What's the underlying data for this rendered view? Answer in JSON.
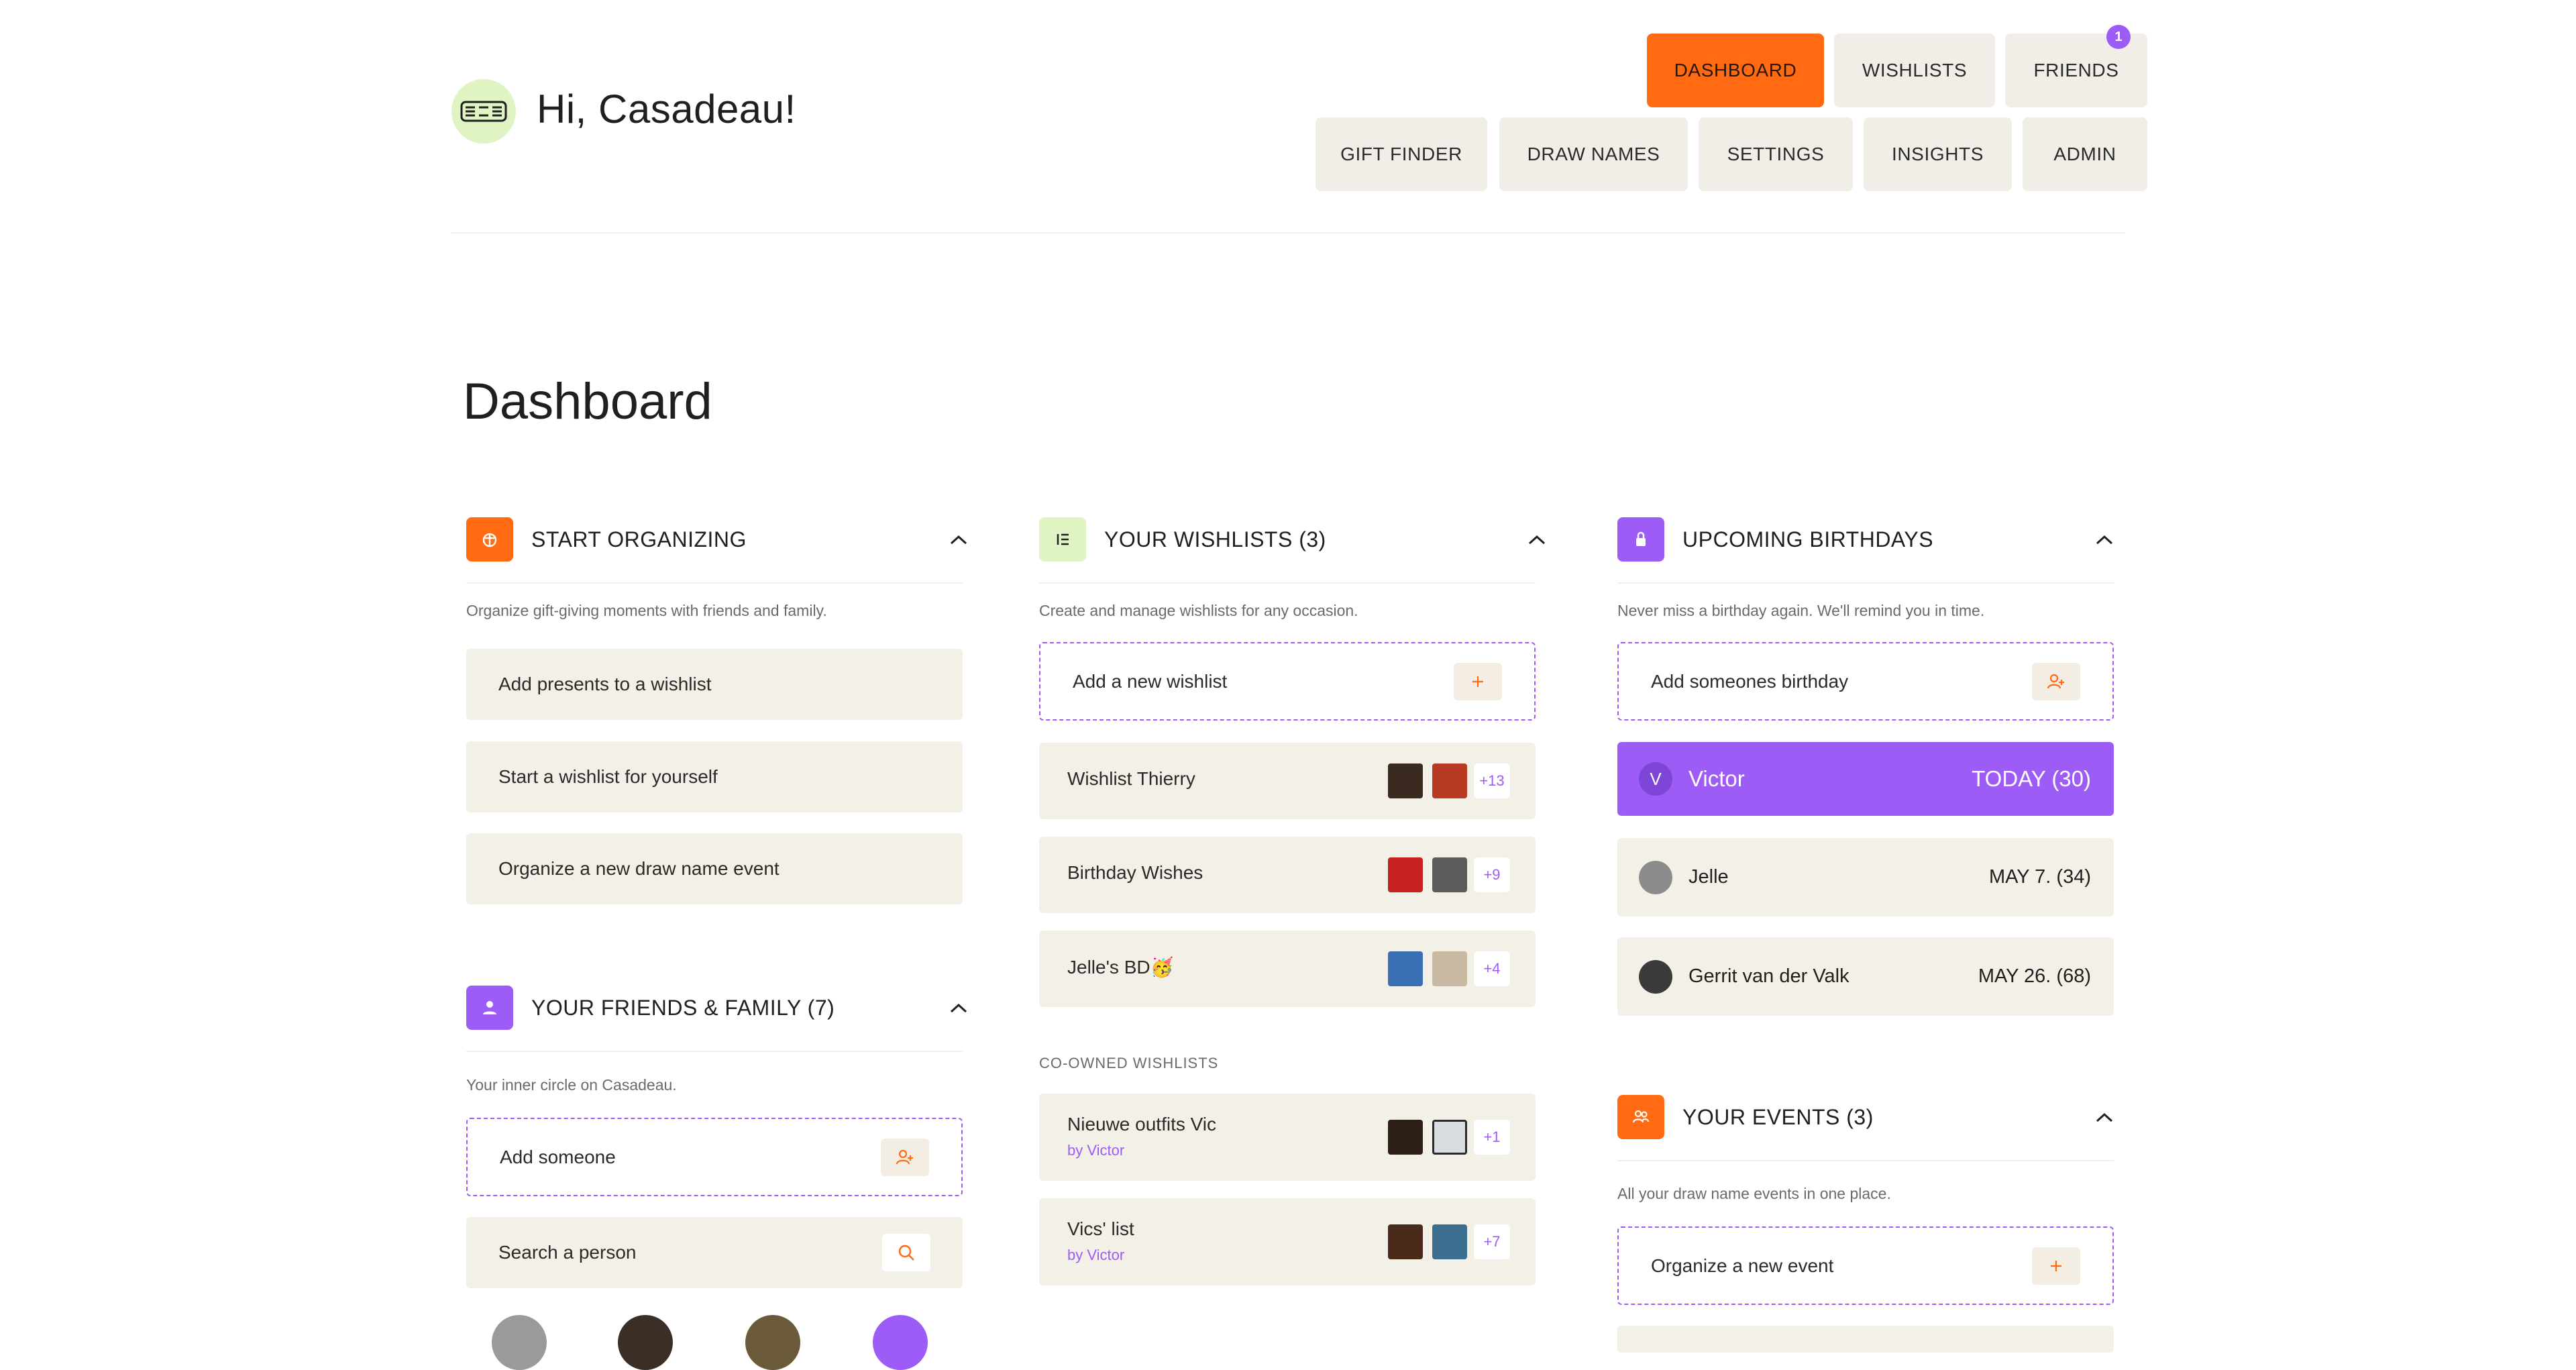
{
  "header": {
    "greeting": "Hi, Casadeau!",
    "logo_icon": "brand-logo-icon"
  },
  "nav": {
    "dashboard": "DASHBOARD",
    "wishlists": "WISHLISTS",
    "friends": "FRIENDS",
    "friends_badge": "1",
    "gift_finder": "GIFT FINDER",
    "draw_names": "DRAW NAMES",
    "settings": "SETTINGS",
    "insights": "INSIGHTS",
    "admin": "ADMIN"
  },
  "page": {
    "title": "Dashboard"
  },
  "colors": {
    "accent_orange": "#ff6a13",
    "accent_purple": "#9e5cf6",
    "accent_green": "#dff3c3",
    "card_bg": "#f3f0e8"
  },
  "start_organizing": {
    "title": "START ORGANIZING",
    "icon": "gift-icon",
    "description": "Organize gift-giving moments with friends and family.",
    "actions": [
      "Add presents to a wishlist",
      "Start a wishlist for yourself",
      "Organize a new draw name event"
    ]
  },
  "friends_family": {
    "title": "YOUR FRIENDS & FAMILY (7)",
    "icon": "person-icon",
    "description": "Your inner circle on Casadeau.",
    "add_label": "Add someone",
    "search_label": "Search a person"
  },
  "wishlists": {
    "title": "YOUR WISHLISTS (3)",
    "icon": "list-icon",
    "description": "Create and manage wishlists for any occasion.",
    "add_label": "Add a new wishlist",
    "items": [
      {
        "name": "Wishlist Thierry",
        "more": "+13"
      },
      {
        "name": "Birthday Wishes",
        "more": "+9"
      },
      {
        "name": "Jelle's BD🥳",
        "more": "+4"
      }
    ],
    "co_owned_label": "CO-OWNED WISHLISTS",
    "co_owned": [
      {
        "name": "Nieuwe outfits Vic",
        "owner": "by Victor",
        "more": "+1"
      },
      {
        "name": "Vics' list",
        "owner": "by Victor",
        "more": "+7"
      }
    ]
  },
  "birthdays": {
    "title": "UPCOMING BIRTHDAYS",
    "icon": "lock-icon",
    "description": "Never miss a birthday again. We'll remind you in time.",
    "add_label": "Add someones birthday",
    "items": [
      {
        "initial": "V",
        "name": "Victor",
        "date": "TODAY (30)"
      },
      {
        "name": "Jelle",
        "date": "MAY 7. (34)"
      },
      {
        "name": "Gerrit van der Valk",
        "date": "MAY 26. (68)"
      }
    ]
  },
  "events": {
    "title": "YOUR EVENTS (3)",
    "icon": "people-icon",
    "description": "All your draw name events in one place.",
    "add_label": "Organize a new event"
  }
}
